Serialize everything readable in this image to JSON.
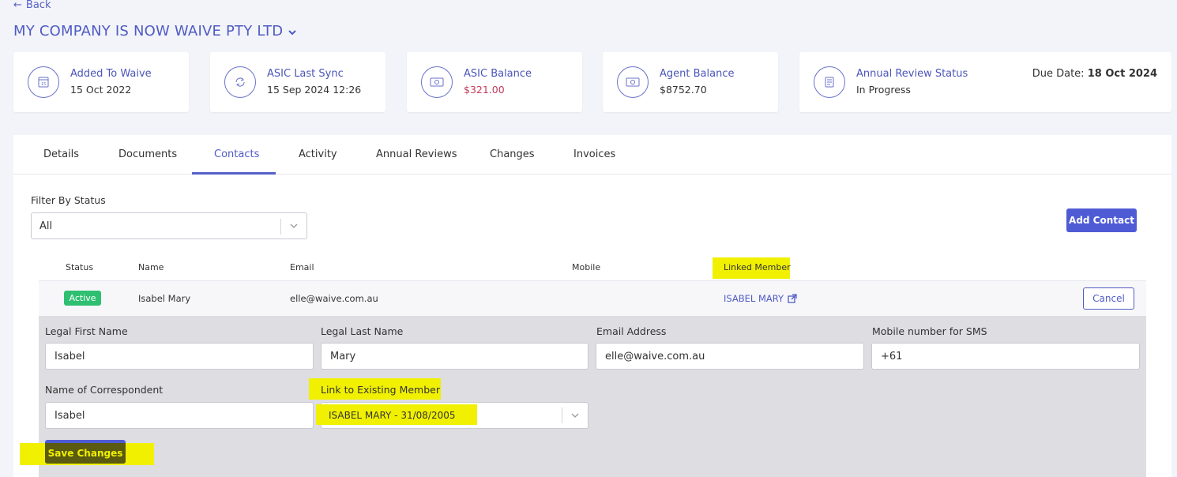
{
  "nav": {
    "back_label": "Back"
  },
  "company": {
    "name": "MY COMPANY IS NOW WAIVE PTY LTD"
  },
  "cards": [
    {
      "title": "Added To Waive",
      "value": "15 Oct 2022",
      "icon": "calendar-icon"
    },
    {
      "title": "ASIC Last Sync",
      "value": "15 Sep 2024 12:26",
      "icon": "sync-icon"
    },
    {
      "title": "ASIC Balance",
      "value": "$321.00",
      "icon": "money-icon",
      "value_color": "#c23a5b"
    },
    {
      "title": "Agent Balance",
      "value": "$8752.70",
      "icon": "money-icon"
    },
    {
      "title": "Annual Review Status",
      "value": "In Progress",
      "icon": "document-icon",
      "due_label": "Due Date:",
      "due_value": "18 Oct 2024"
    }
  ],
  "tabs": [
    {
      "label": "Details"
    },
    {
      "label": "Documents"
    },
    {
      "label": "Contacts",
      "active": true
    },
    {
      "label": "Activity"
    },
    {
      "label": "Annual Reviews"
    },
    {
      "label": "Changes"
    },
    {
      "label": "Invoices"
    }
  ],
  "filter": {
    "label": "Filter By Status",
    "value": "All"
  },
  "add_contact_label": "Add Contact",
  "table": {
    "headers": [
      "Status",
      "Name",
      "Email",
      "Mobile",
      "Linked Member"
    ],
    "row": {
      "status": "Active",
      "name": "Isabel Mary",
      "email": "elle@waive.com.au",
      "mobile": "",
      "linked_member": "ISABEL MARY",
      "cancel_label": "Cancel"
    }
  },
  "edit_form": {
    "first_name": {
      "label": "Legal First Name",
      "value": "Isabel"
    },
    "last_name": {
      "label": "Legal Last Name",
      "value": "Mary"
    },
    "email": {
      "label": "Email Address",
      "value": "elle@waive.com.au"
    },
    "mobile": {
      "label": "Mobile number for SMS",
      "value": "+61"
    },
    "correspondent": {
      "label": "Name of Correspondent",
      "value": "Isabel"
    },
    "link_member": {
      "label": "Link to Existing Member",
      "value": "ISABEL MARY - 31/08/2005"
    },
    "save_label": "Save Changes"
  },
  "colors": {
    "accent": "#4f5bd5",
    "active_badge": "#2fbf71",
    "highlight": "#f0f000",
    "negative": "#c23a5b"
  }
}
